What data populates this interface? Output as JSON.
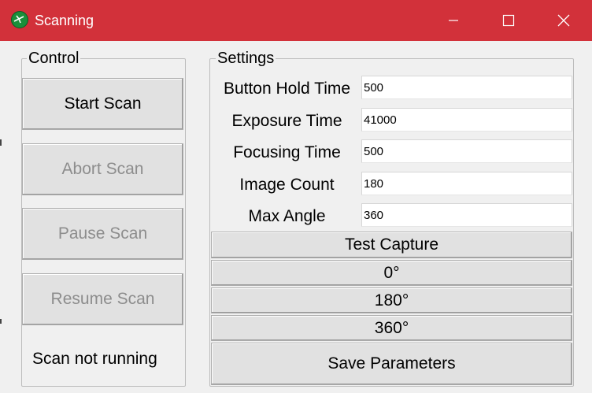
{
  "window": {
    "title": "Scanning",
    "title_bar_color": "#d2313a",
    "icon": "app-logo-icon",
    "controls": {
      "minimize_icon": "minimize-icon",
      "maximize_icon": "maximize-icon",
      "close_icon": "close-icon"
    }
  },
  "control": {
    "legend": "Control",
    "start_label": "Start Scan",
    "abort_label": "Abort Scan",
    "pause_label": "Pause Scan",
    "resume_label": "Resume Scan",
    "status_text": "Scan not running",
    "disabled_buttons": [
      "Abort Scan",
      "Pause Scan",
      "Resume Scan"
    ]
  },
  "settings": {
    "legend": "Settings",
    "fields": [
      {
        "label": "Button Hold Time",
        "value": "500"
      },
      {
        "label": "Exposure Time",
        "value": "41000"
      },
      {
        "label": "Focusing Time",
        "value": "500"
      },
      {
        "label": "Image Count",
        "value": "180"
      },
      {
        "label": "Max Angle",
        "value": "360"
      }
    ],
    "test_capture_label": "Test Capture",
    "angle_buttons": [
      "0°",
      "180°",
      "360°"
    ],
    "save_label": "Save Parameters"
  }
}
